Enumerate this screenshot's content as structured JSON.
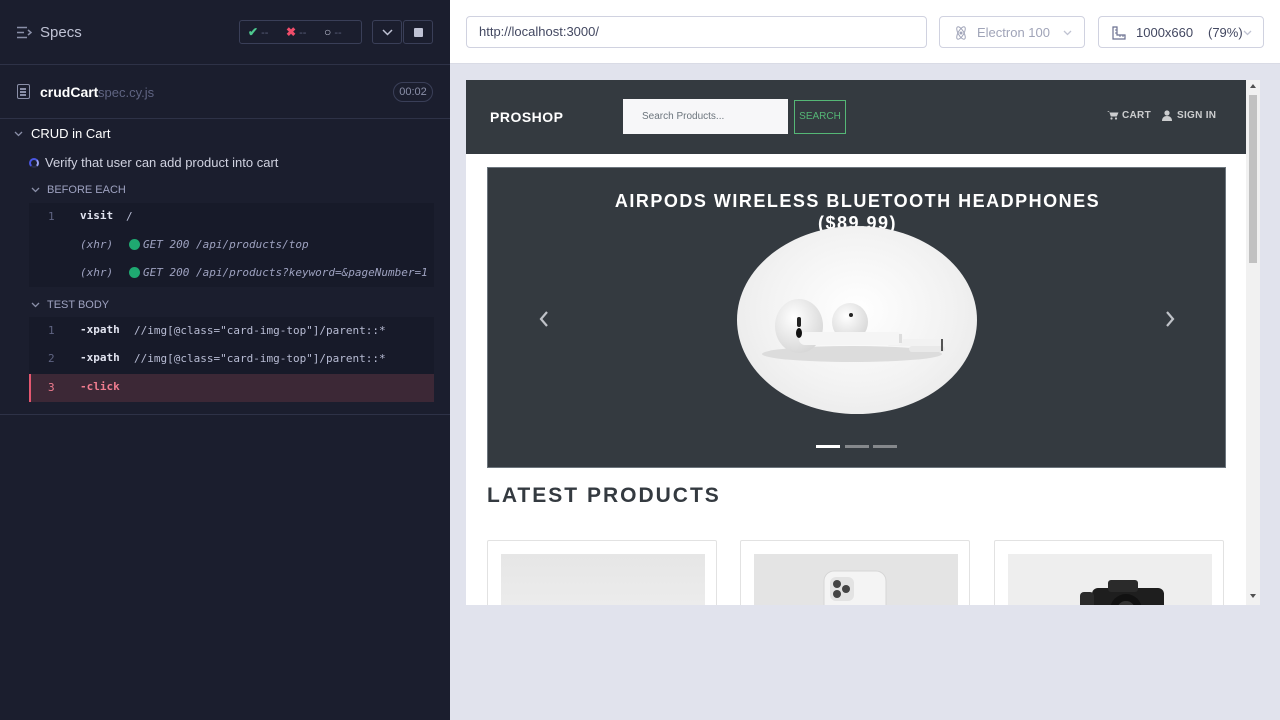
{
  "reporter": {
    "specs_title": "Specs",
    "stats": {
      "passed_symbol": "✔",
      "passed_count": "--",
      "failed_symbol": "✖",
      "failed_count": "--",
      "pending_symbol": "○",
      "pending_count": "--"
    },
    "file": {
      "name": "crudCart",
      "ext": "spec.cy.js",
      "duration": "00:02"
    },
    "suite_title": "CRUD in Cart",
    "test_title": "Verify that user can add product into cart",
    "before_each": {
      "label": "BEFORE EACH",
      "commands": [
        {
          "num": "1",
          "name": "visit",
          "arg": "/"
        },
        {
          "kind": "(xhr)",
          "arg": "GET 200 /api/products/top"
        },
        {
          "kind": "(xhr)",
          "arg": "GET 200 /api/products?keyword=&pageNumber=1"
        }
      ]
    },
    "test_body": {
      "label": "TEST BODY",
      "commands": [
        {
          "num": "1",
          "name": "-xpath",
          "arg": "//img[@class=\"card-img-top\"]/parent::*"
        },
        {
          "num": "2",
          "name": "-xpath",
          "arg": "//img[@class=\"card-img-top\"]/parent::*"
        },
        {
          "num": "3",
          "name": "-click",
          "state": "failed"
        }
      ]
    }
  },
  "aut_header": {
    "url": "http://localhost:3000/",
    "browser": "Electron 100",
    "viewport": "1000x660",
    "zoom": "(79%)"
  },
  "app": {
    "brand": "PROSHOP",
    "search_placeholder": "Search Products...",
    "search_button": "SEARCH",
    "nav_cart": "CART",
    "nav_signin": "SIGN IN",
    "carousel": {
      "title_line1": "AIRPODS WIRELESS BLUETOOTH HEADPHONES",
      "title_line2": "($89.99)",
      "slides": 3,
      "active_slide": 1
    },
    "latest_heading": "LATEST PRODUCTS"
  },
  "colors": {
    "reporter_bg": "#1b1e2e",
    "pass": "#4ec98f",
    "fail": "#f04d6a",
    "navbar": "#343a40",
    "search_green": "#55b776"
  }
}
